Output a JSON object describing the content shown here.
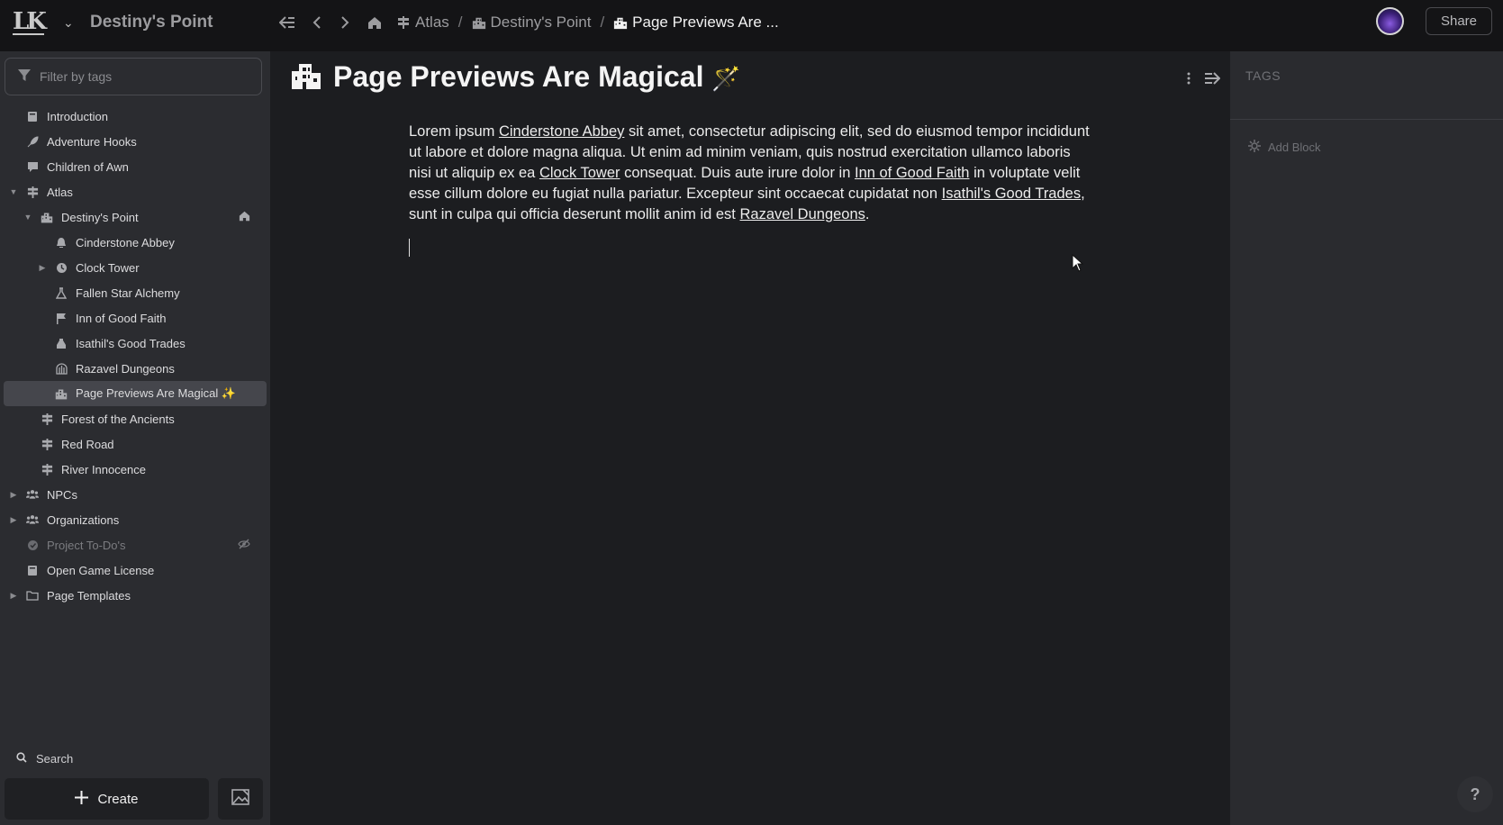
{
  "topbar": {
    "world_title": "Destiny's Point",
    "breadcrumbs": [
      {
        "label": "Atlas",
        "icon": "signpost-icon"
      },
      {
        "label": "Destiny's Point",
        "icon": "city-icon"
      },
      {
        "label": "Page Previews Are ...",
        "icon": "city-icon"
      }
    ],
    "share_label": "Share"
  },
  "sidebar": {
    "filter_placeholder": "Filter by tags",
    "items": [
      {
        "label": "Introduction",
        "icon": "book-icon",
        "depth": 0,
        "caret": ""
      },
      {
        "label": "Adventure Hooks",
        "icon": "quill-icon",
        "depth": 0,
        "caret": ""
      },
      {
        "label": "Children of Awn",
        "icon": "chat-icon",
        "depth": 0,
        "caret": ""
      },
      {
        "label": "Atlas",
        "icon": "signpost-icon",
        "depth": 0,
        "caret": "down"
      },
      {
        "label": "Destiny's Point",
        "icon": "city-icon",
        "depth": 1,
        "caret": "down",
        "trail": "home-icon"
      },
      {
        "label": "Cinderstone Abbey",
        "icon": "bell-icon",
        "depth": 2,
        "caret": ""
      },
      {
        "label": "Clock Tower",
        "icon": "clock-icon",
        "depth": 2,
        "caret": "right"
      },
      {
        "label": "Fallen Star Alchemy",
        "icon": "flask-icon",
        "depth": 2,
        "caret": ""
      },
      {
        "label": "Inn of Good Faith",
        "icon": "flag-icon",
        "depth": 2,
        "caret": ""
      },
      {
        "label": "Isathil's Good Trades",
        "icon": "pot-icon",
        "depth": 2,
        "caret": ""
      },
      {
        "label": "Razavel Dungeons",
        "icon": "dungeon-icon",
        "depth": 2,
        "caret": ""
      },
      {
        "label": "Page Previews Are Magical ✨",
        "icon": "city-icon",
        "depth": 2,
        "caret": "",
        "selected": true
      },
      {
        "label": "Forest of the Ancients",
        "icon": "signpost-icon",
        "depth": 1,
        "caret": ""
      },
      {
        "label": "Red Road",
        "icon": "signpost-icon",
        "depth": 1,
        "caret": ""
      },
      {
        "label": "River Innocence",
        "icon": "signpost-icon",
        "depth": 1,
        "caret": ""
      },
      {
        "label": "NPCs",
        "icon": "people-icon",
        "depth": 0,
        "caret": "right"
      },
      {
        "label": "Organizations",
        "icon": "people-icon",
        "depth": 0,
        "caret": "right"
      },
      {
        "label": "Project To-Do's",
        "icon": "check-icon",
        "depth": 0,
        "caret": "",
        "dim": true,
        "trail": "eye-off-icon"
      },
      {
        "label": "Open Game License",
        "icon": "book-icon",
        "depth": 0,
        "caret": ""
      },
      {
        "label": "Page Templates",
        "icon": "folder-icon",
        "depth": 0,
        "caret": "right"
      }
    ],
    "search_label": "Search",
    "create_label": "Create"
  },
  "main": {
    "title": "Page Previews Are Magical",
    "title_emoji": "🪄",
    "body": [
      {
        "t": "Lorem ipsum "
      },
      {
        "t": "Cinderstone Abbey",
        "link": true
      },
      {
        "t": " sit amet, consectetur adipiscing elit, sed do eiusmod tempor incididunt ut labore et dolore magna aliqua. Ut enim ad minim veniam, quis nostrud exercitation ullamco laboris nisi ut aliquip ex ea "
      },
      {
        "t": "Clock Tower",
        "link": true
      },
      {
        "t": " consequat. Duis aute irure dolor in "
      },
      {
        "t": "Inn of Good Faith",
        "link": true
      },
      {
        "t": " in voluptate velit esse cillum dolore eu fugiat nulla pariatur. Excepteur sint occaecat cupidatat non "
      },
      {
        "t": "Isathil's Good Trades",
        "link": true
      },
      {
        "t": ", sunt in culpa qui officia deserunt mollit anim id est "
      },
      {
        "t": "Razavel Dungeons",
        "link": true
      },
      {
        "t": "."
      }
    ]
  },
  "right_panel": {
    "tags_label": "TAGS",
    "add_block_label": "Add Block"
  },
  "help_label": "?"
}
